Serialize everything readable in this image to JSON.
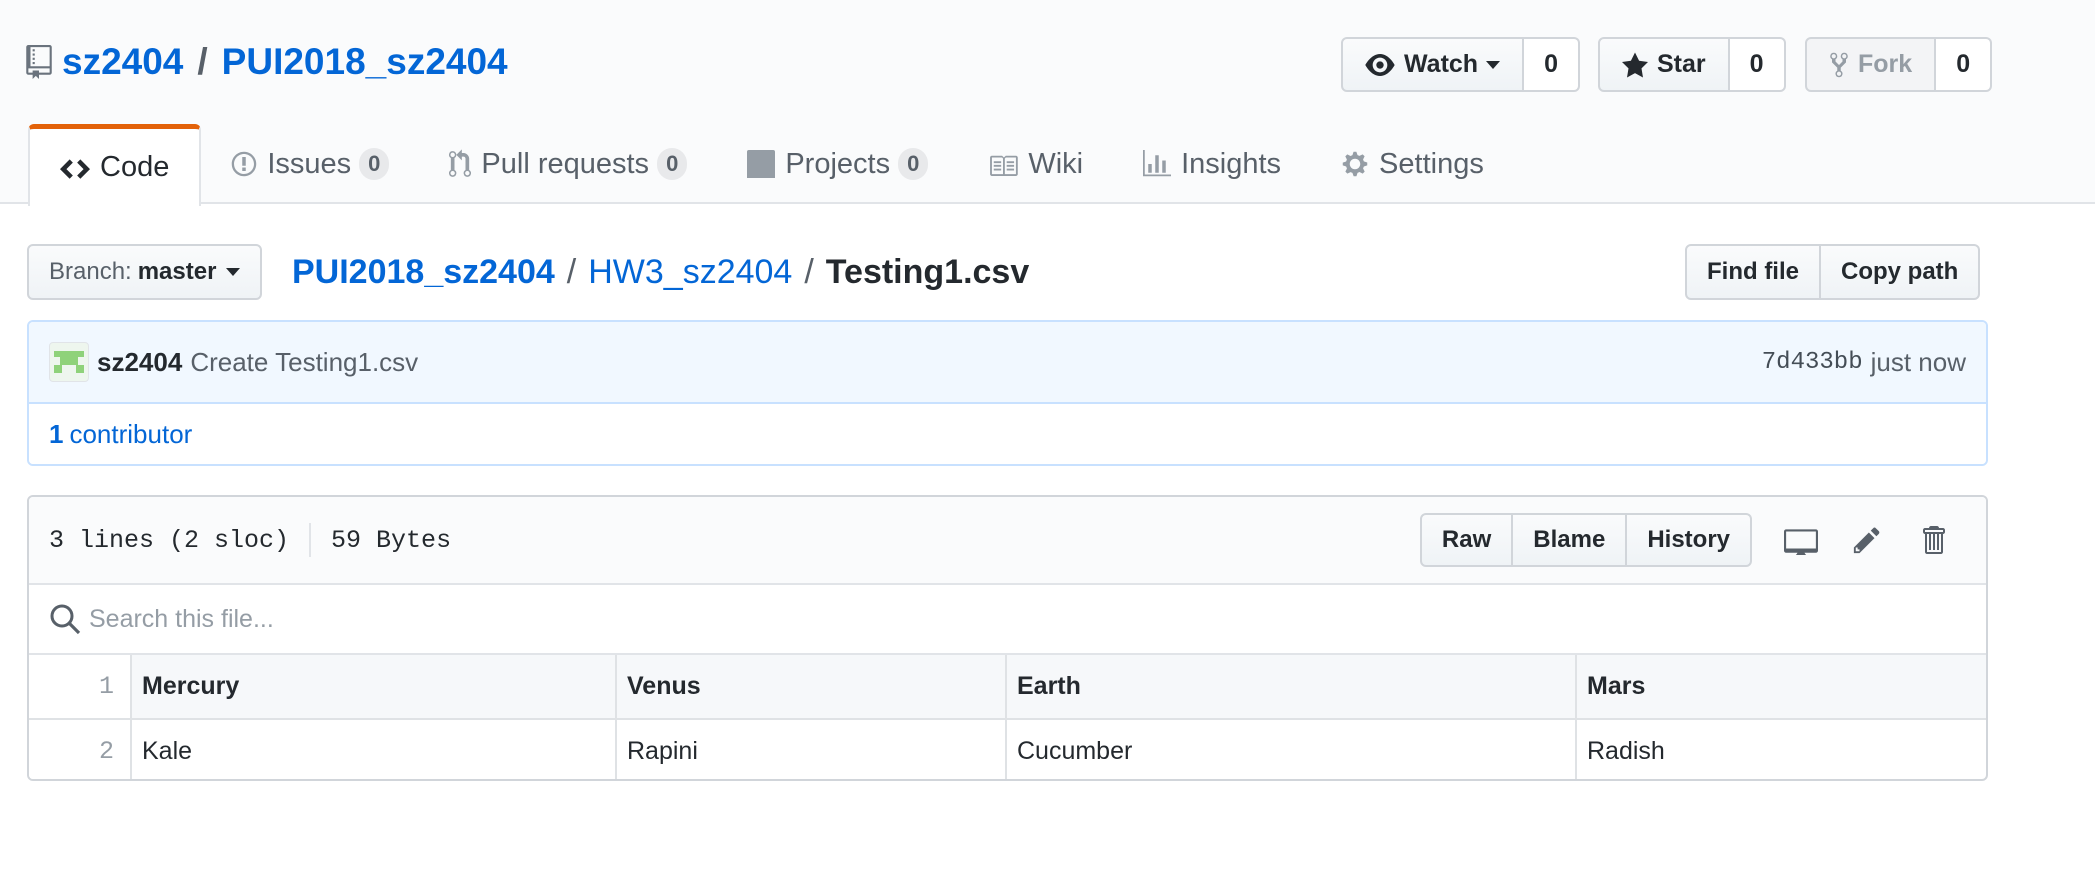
{
  "repo": {
    "owner": "sz2404",
    "separator": "/",
    "name": "PUI2018_sz2404"
  },
  "actions": {
    "watch": {
      "label": "Watch",
      "count": "0"
    },
    "star": {
      "label": "Star",
      "count": "0"
    },
    "fork": {
      "label": "Fork",
      "count": "0"
    }
  },
  "tabs": [
    {
      "label": "Code",
      "icon": "code-icon",
      "selected": true
    },
    {
      "label": "Issues",
      "count": "0",
      "icon": "issue-opened-icon"
    },
    {
      "label": "Pull requests",
      "count": "0",
      "icon": "git-pull-request-icon"
    },
    {
      "label": "Projects",
      "count": "0",
      "icon": "project-icon"
    },
    {
      "label": "Wiki",
      "icon": "book-icon"
    },
    {
      "label": "Insights",
      "icon": "graph-icon"
    },
    {
      "label": "Settings",
      "icon": "gear-icon"
    }
  ],
  "branch": {
    "prefix": "Branch:",
    "name": "master"
  },
  "breadcrumb": {
    "root": "PUI2018_sz2404",
    "dir": "HW3_sz2404",
    "file": "Testing1.csv",
    "sep": "/"
  },
  "file_nav": {
    "find_file": "Find file",
    "copy_path": "Copy path"
  },
  "commit": {
    "author": "sz2404",
    "message": "Create Testing1.csv",
    "sha": "7d433bb",
    "time": "just now"
  },
  "contributors": {
    "count": "1",
    "label": "contributor"
  },
  "file": {
    "lines": "3 lines (2 sloc)",
    "size": "59 Bytes",
    "raw": "Raw",
    "blame": "Blame",
    "history": "History",
    "search_placeholder": "Search this file..."
  },
  "csv": {
    "header_line": "1",
    "headers": [
      "Mercury",
      "Venus",
      "Earth",
      "Mars"
    ],
    "rows": [
      {
        "line": "2",
        "cells": [
          "Kale",
          "Rapini",
          "Cucumber",
          "Radish"
        ]
      }
    ]
  },
  "colors": {
    "link": "#0366d6",
    "tab_accent": "#e36209",
    "commit_bg": "#f1f8ff",
    "border": "#d1d5da"
  }
}
